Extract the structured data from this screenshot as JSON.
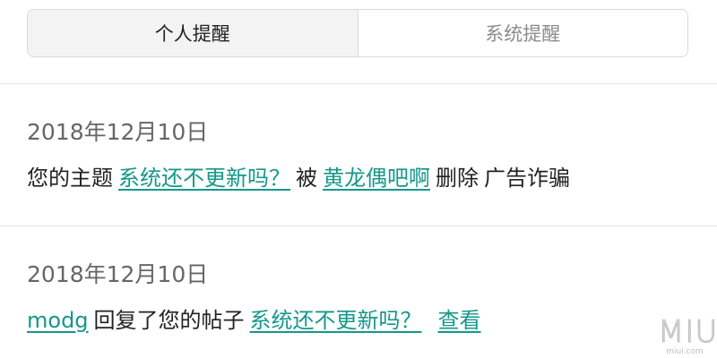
{
  "tabs": [
    {
      "label": "个人提醒",
      "active": true
    },
    {
      "label": "系统提醒",
      "active": false
    }
  ],
  "notices": [
    {
      "date": "2018年12月10日",
      "prefix": "您的主题",
      "topic_link": "系统还不更新吗？",
      "by": "被",
      "user_link": "黄龙偶吧啊",
      "action": "删除",
      "reason": "广告诈骗"
    },
    {
      "date": "2018年12月10日",
      "user_link": "modg",
      "action": "回复了您的帖子",
      "topic_link": "系统还不更新吗？",
      "view_link": "查看"
    }
  ],
  "watermark": {
    "logo": "MIUI",
    "site": "miui.com"
  },
  "colors": {
    "link": "#14988a",
    "active_tab_bg": "#f3f3f3",
    "border": "#d9d9d9"
  }
}
